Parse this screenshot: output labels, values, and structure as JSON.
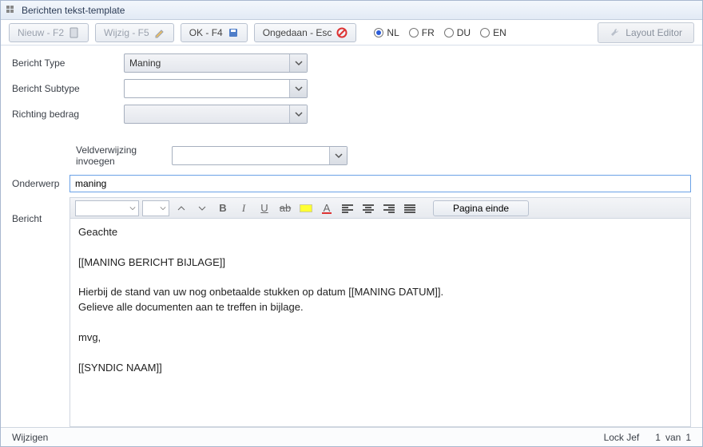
{
  "window": {
    "title": "Berichten tekst-template"
  },
  "toolbar": {
    "new": {
      "label": "Nieuw - F2"
    },
    "edit": {
      "label": "Wijzig - F5"
    },
    "ok": {
      "label": "OK - F4"
    },
    "undo": {
      "label": "Ongedaan - Esc"
    },
    "layout": {
      "label": "Layout Editor"
    },
    "lang": {
      "options": [
        "NL",
        "FR",
        "DU",
        "EN"
      ],
      "selected": "NL"
    }
  },
  "form": {
    "type_label": "Bericht Type",
    "type_value": "Maning",
    "subtype_label": "Bericht Subtype",
    "subtype_value": "",
    "direction_label": "Richting bedrag",
    "direction_value": "",
    "insert_label": "Veldverwijzing invoegen",
    "insert_value": "",
    "subject_label": "Onderwerp",
    "subject_value": "maning",
    "body_label": "Bericht"
  },
  "editor": {
    "page_break_label": "Pagina einde",
    "body": "Geachte\n\n[[MANING BERICHT BIJLAGE]]\n\nHierbij de stand van uw nog onbetaalde stukken op datum [[MANING DATUM]].\nGelieve alle documenten aan te treffen in bijlage.\n\nmvg,\n\n[[SYNDIC NAAM]]"
  },
  "status": {
    "mode": "Wijzigen",
    "lock": "Lock Jef",
    "pos": "1",
    "sep": "van",
    "total": "1"
  }
}
